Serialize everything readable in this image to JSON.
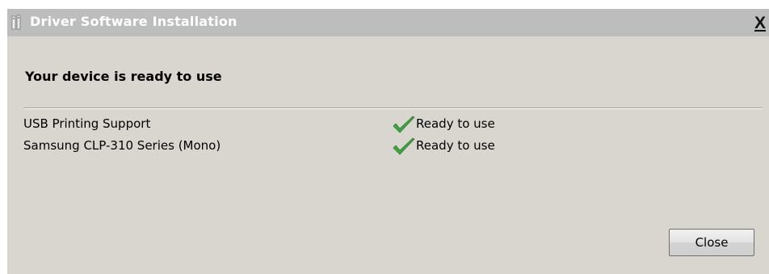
{
  "window": {
    "title": "Driver Software Installation",
    "close_glyph": "X"
  },
  "main": {
    "heading": "Your device is ready to use",
    "devices": [
      {
        "name": "USB Printing Support",
        "status": "Ready to use",
        "status_icon": "checkmark-icon"
      },
      {
        "name": "Samsung CLP-310 Series (Mono)",
        "status": "Ready to use",
        "status_icon": "checkmark-icon"
      }
    ]
  },
  "footer": {
    "close_label": "Close"
  },
  "colors": {
    "dialog_bg": "#d9d6d0",
    "titlebar_bg": "#bdbdbd",
    "check_green": "#3fa33f"
  }
}
